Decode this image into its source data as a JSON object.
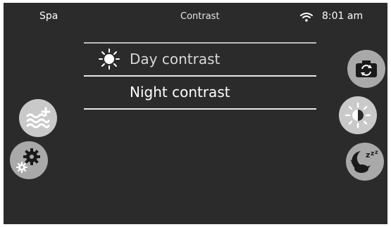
{
  "status_bar": {
    "app_name": "Spa",
    "title": "Contrast",
    "time": "8:01 am",
    "wifi_icon": "wifi-icon"
  },
  "contrast_menu": {
    "items": [
      {
        "label": "Day contrast",
        "icon": "sun-icon"
      },
      {
        "label": "Night contrast",
        "icon": "moon-icon"
      }
    ]
  },
  "left_buttons": [
    {
      "icon": "water-temperature-icon"
    },
    {
      "icon": "settings-gears-icon"
    }
  ],
  "right_buttons": [
    {
      "icon": "camera-switch-icon"
    },
    {
      "icon": "brightness-icon"
    },
    {
      "icon": "night-sleep-icon"
    }
  ],
  "colors": {
    "background": "#2b2b2b",
    "button": "#a9a9a9",
    "text": "#ffffff"
  }
}
